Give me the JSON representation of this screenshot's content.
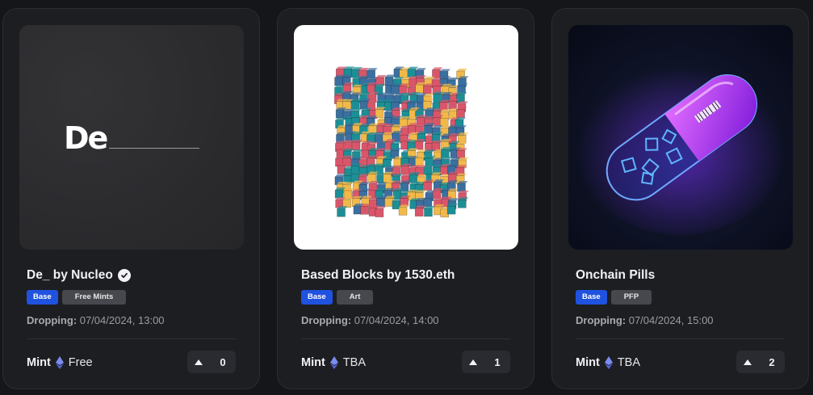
{
  "cards": [
    {
      "title": "De_ by Nucleo",
      "verified": true,
      "art_text": "De",
      "tags": [
        "Base",
        "Free Mints"
      ],
      "dropping_label": "Dropping:",
      "dropping_value": "07/04/2024, 13:00",
      "mint_label": "Mint",
      "mint_price": "Free",
      "votes": "0"
    },
    {
      "title": "Based Blocks by 1530.eth",
      "tags": [
        "Base",
        "Art"
      ],
      "dropping_label": "Dropping:",
      "dropping_value": "07/04/2024, 14:00",
      "mint_label": "Mint",
      "mint_price": "TBA",
      "votes": "1"
    },
    {
      "title": "Onchain Pills",
      "tags": [
        "Base",
        "PFP"
      ],
      "dropping_label": "Dropping:",
      "dropping_value": "07/04/2024, 15:00",
      "mint_label": "Mint",
      "mint_price": "TBA",
      "votes": "2"
    }
  ],
  "colors": {
    "base_tag": "#2052e0",
    "block_palette": [
      "#d9566a",
      "#3a6fa0",
      "#f1b94a",
      "#1c8f96"
    ]
  },
  "icons": {
    "verified": "check-circle-icon",
    "currency": "ethereum-icon",
    "upvote": "triangle-up-icon"
  }
}
